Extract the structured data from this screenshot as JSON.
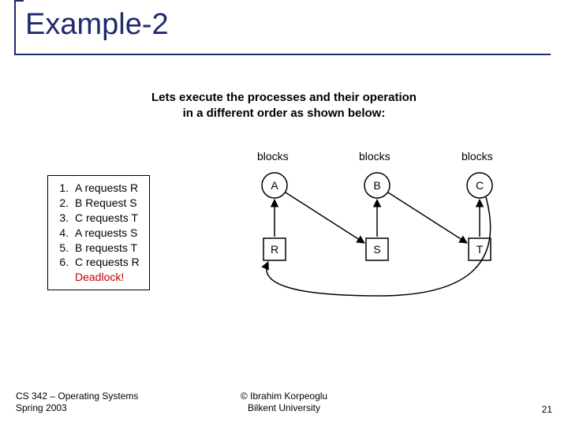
{
  "title": "Example-2",
  "intro_line1": "Lets execute the processes and their operation",
  "intro_line2": "in a different order as shown below:",
  "blocks_label": "blocks",
  "steps": {
    "s1": "A requests R",
    "s2": "B Request S",
    "s3": "C requests T",
    "s4": "A requests S",
    "s5": "B requests T",
    "s6": "C requests R",
    "deadlock": "Deadlock!"
  },
  "diagram": {
    "nodes": {
      "A": "A",
      "B": "B",
      "C": "C",
      "R": "R",
      "S": "S",
      "T": "T"
    }
  },
  "footer": {
    "course": "CS 342 – Operating Systems",
    "term": "Spring 2003",
    "credit1": "© Ibrahim Korpeoglu",
    "credit2": "Bilkent University",
    "page": "21"
  }
}
